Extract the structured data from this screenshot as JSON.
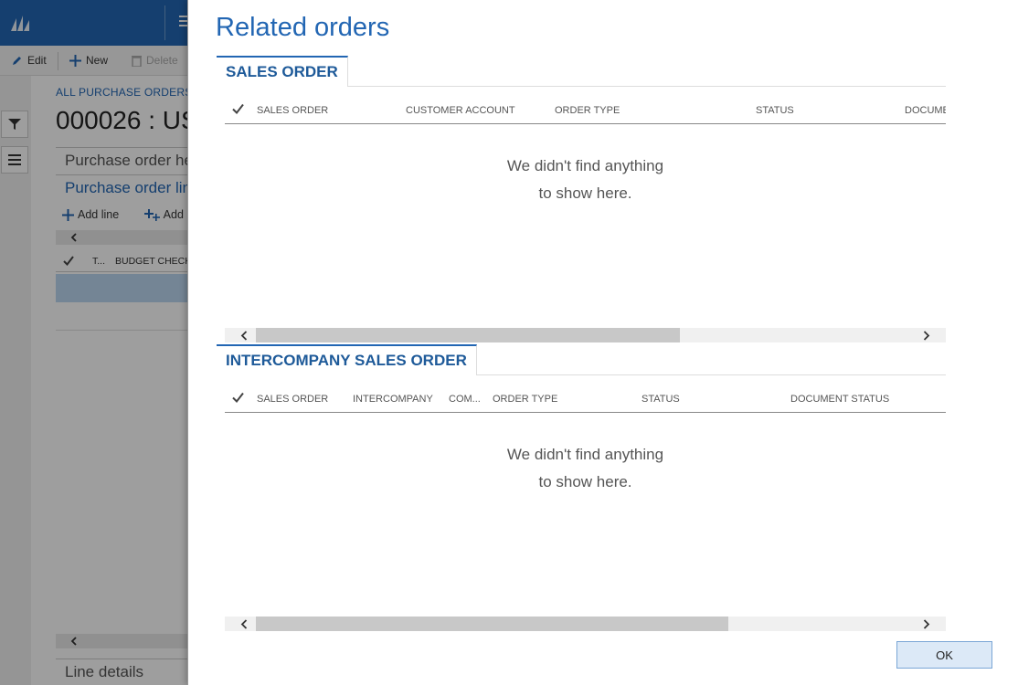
{
  "background": {
    "actions": {
      "edit": "Edit",
      "new": "New",
      "delete": "Delete"
    },
    "breadcrumb": "ALL PURCHASE ORDERS",
    "title": "000026 : US",
    "sections": {
      "header": "Purchase order he",
      "lines": "Purchase order lin"
    },
    "line_actions": {
      "add_line": "Add line",
      "add_lines": "Add li"
    },
    "grid_head": {
      "t": "T...",
      "budget": "BUDGET CHECK"
    },
    "line_details": "Line details",
    "colors": {
      "brand": "#2266b3",
      "selected_row": "#bcd7f0"
    }
  },
  "dialog": {
    "title": "Related orders",
    "sales_order": {
      "tab": "SALES ORDER",
      "columns": [
        "SALES ORDER",
        "CUSTOMER ACCOUNT",
        "ORDER TYPE",
        "STATUS",
        "DOCUME"
      ],
      "empty_line1": "We didn't find anything",
      "empty_line2": "to show here."
    },
    "intercompany": {
      "tab": "INTERCOMPANY SALES ORDER",
      "columns": [
        "SALES ORDER",
        "INTERCOMPANY",
        "COM...",
        "ORDER TYPE",
        "STATUS",
        "DOCUMENT STATUS"
      ],
      "empty_line1": "We didn't find anything",
      "empty_line2": "to show here."
    },
    "ok": "OK",
    "icons": [
      "check-icon",
      "chevron-left-icon",
      "chevron-right-icon"
    ]
  }
}
